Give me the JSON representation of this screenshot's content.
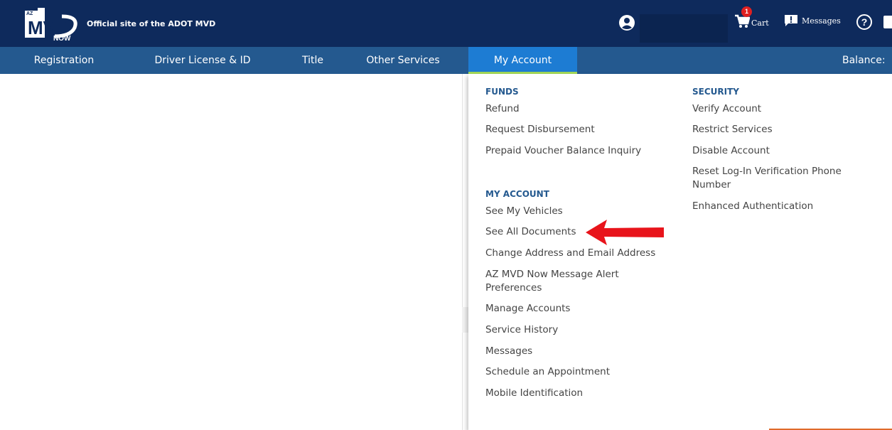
{
  "header": {
    "logo_text_az": "AZ",
    "logo_text_mvd": "MVD",
    "logo_text_now": "NOW",
    "tagline": "Official site of the ADOT MVD",
    "cart": {
      "label": "Cart",
      "badge_count": "1"
    },
    "messages_label": "Messages",
    "help_glyph": "?",
    "icons": [
      "user-icon",
      "cart-icon",
      "messages-icon",
      "help-icon",
      "flag-icon"
    ]
  },
  "nav": {
    "items": [
      "Registration",
      "Driver License & ID",
      "Title",
      "Other Services",
      "My Account"
    ],
    "active": "My Account",
    "balance_label": "Balance:"
  },
  "dropdown": {
    "funds": {
      "title": "FUNDS",
      "links": [
        "Refund",
        "Request Disbursement",
        "Prepaid Voucher Balance Inquiry"
      ]
    },
    "my_account": {
      "title": "MY ACCOUNT",
      "links": [
        "See My Vehicles",
        "See All Documents",
        "Change Address and Email Address",
        "AZ MVD Now Message Alert",
        "Preferences",
        "Manage Accounts",
        "Service History",
        "Messages",
        "Schedule an Appointment",
        "Mobile Identification"
      ]
    },
    "security": {
      "title": "SECURITY",
      "links": [
        "Verify Account",
        "Restrict Services",
        "Disable Account",
        "Reset Log-In Verification Phone",
        "Number",
        "Enhanced Authentication"
      ]
    }
  },
  "colors": {
    "header_bg": "#0e2a5c",
    "nav_bg": "#24598f",
    "nav_active_bg": "#1d7cd3",
    "nav_active_underline": "#a3d957",
    "section_title": "#24598f",
    "annotation_arrow": "#e8141b"
  }
}
